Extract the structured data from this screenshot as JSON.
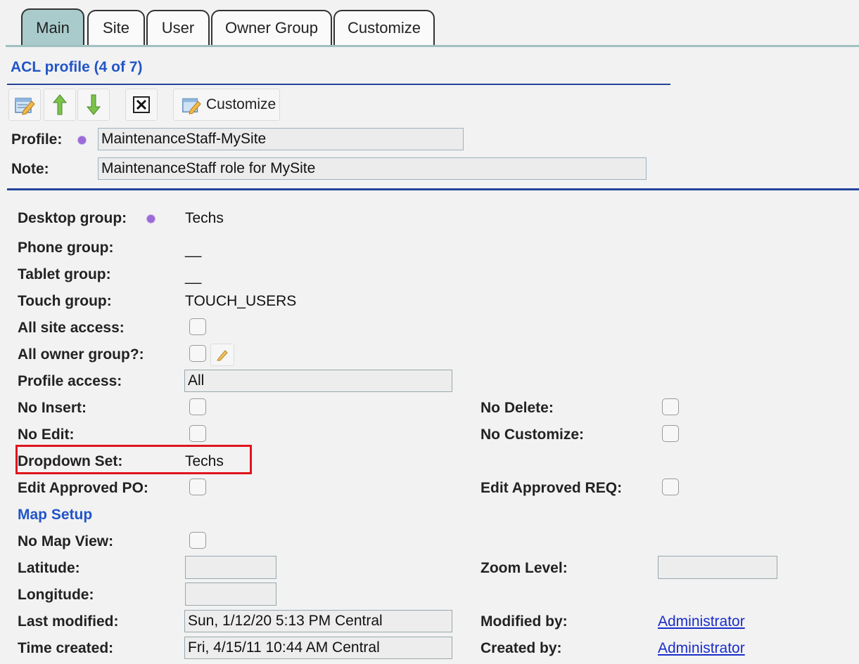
{
  "tabs": [
    "Main",
    "Site",
    "User",
    "Owner Group",
    "Customize"
  ],
  "header": {
    "title": "ACL profile (4 of 7)"
  },
  "toolbar": {
    "icons": [
      "edit-icon",
      "arrow-up-icon",
      "arrow-down-icon",
      "close-box-icon",
      "customize-icon"
    ],
    "customize_label": "Customize"
  },
  "profile": {
    "profile_label": "Profile:",
    "profile_value": "MaintenanceStaff-MySite",
    "note_label": "Note:",
    "note_value": "MaintenanceStaff role for MySite"
  },
  "details": {
    "desktop_group_label": "Desktop group:",
    "desktop_group_value": "Techs",
    "phone_group_label": "Phone group:",
    "phone_group_value": "__",
    "tablet_group_label": "Tablet group:",
    "tablet_group_value": "__",
    "touch_group_label": "Touch group:",
    "touch_group_value": "TOUCH_USERS",
    "all_site_access_label": "All site access:",
    "all_owner_group_label": "All owner group?:",
    "profile_access_label": "Profile access:",
    "profile_access_value": "All",
    "no_insert_label": "No Insert:",
    "no_delete_label": "No Delete:",
    "no_edit_label": "No Edit:",
    "no_customize_label": "No Customize:",
    "dropdown_set_label": "Dropdown Set:",
    "dropdown_set_value": "Techs",
    "edit_approved_po_label": "Edit Approved PO:",
    "edit_approved_req_label": "Edit Approved REQ:"
  },
  "map": {
    "title": "Map Setup",
    "no_map_view_label": "No Map View:",
    "latitude_label": "Latitude:",
    "latitude_value": "",
    "longitude_label": "Longitude:",
    "longitude_value": "",
    "zoom_level_label": "Zoom Level:",
    "zoom_level_value": ""
  },
  "audit": {
    "last_modified_label": "Last modified:",
    "last_modified_value": "Sun, 1/12/20 5:13 PM Central",
    "time_created_label": "Time created:",
    "time_created_value": "Fri, 4/15/11 10:44 AM Central",
    "modified_by_label": "Modified by:",
    "modified_by_value": "Administrator",
    "created_by_label": "Created by:",
    "created_by_value": "Administrator"
  },
  "colors": {
    "accent_blue": "#2155c7",
    "tab_active": "#a9cbcc",
    "highlight_red": "#e0141c",
    "required_dot": "#9b6ad8"
  }
}
